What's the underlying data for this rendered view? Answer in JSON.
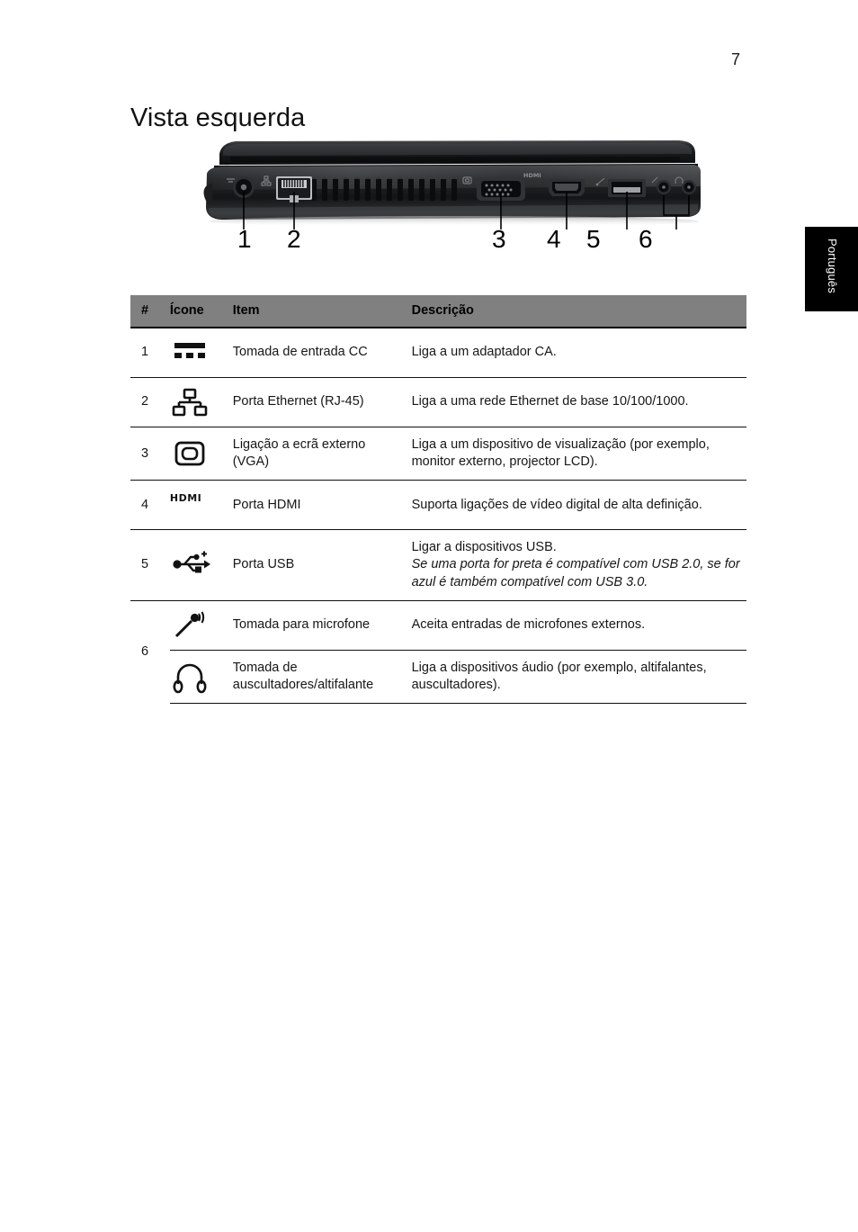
{
  "page": {
    "number": "7",
    "title": "Vista esquerda",
    "language_tab": "Português"
  },
  "figure": {
    "name": "laptop-left-side-view",
    "callouts": [
      {
        "label": "1",
        "target": "dc-in-jack"
      },
      {
        "label": "2",
        "target": "ethernet-port"
      },
      {
        "label": "3",
        "target": "vga-port"
      },
      {
        "label": "4",
        "target": "hdmi-port"
      },
      {
        "label": "5",
        "target": "usb-port"
      },
      {
        "label": "6",
        "target": "audio-jacks"
      }
    ]
  },
  "table": {
    "headers": {
      "num": "#",
      "icon": "Ícone",
      "item": "Item",
      "description": "Descrição"
    },
    "rows": [
      {
        "num": "1",
        "icon": "dc-in-icon",
        "item": "Tomada de entrada CC",
        "description": "Liga a um adaptador CA."
      },
      {
        "num": "2",
        "icon": "ethernet-icon",
        "item": "Porta Ethernet (RJ-45)",
        "description": "Liga a uma rede Ethernet de base 10/100/1000."
      },
      {
        "num": "3",
        "icon": "external-display-icon",
        "item": "Ligação a ecrã externo (VGA)",
        "description": "Liga a um dispositivo de visualização (por exemplo, monitor externo, projector LCD)."
      },
      {
        "num": "4",
        "icon": "hdmi-icon",
        "icon_text": "HDMI",
        "item": "Porta HDMI",
        "description": "Suporta ligações de vídeo digital de alta definição."
      },
      {
        "num": "5",
        "icon": "usb-icon",
        "item": "Porta USB",
        "description": "Ligar a dispositivos USB.",
        "description_italic": "Se uma porta for preta é compatível com USB 2.0, se for azul é também compatível com USB 3.0."
      },
      {
        "num": "6",
        "sub_rows": [
          {
            "icon": "microphone-icon",
            "item": "Tomada para microfone",
            "description": "Aceita entradas de microfones externos."
          },
          {
            "icon": "headphones-icon",
            "item": "Tomada de auscultadores/altifalante",
            "description": "Liga a dispositivos áudio (por exemplo, altifalantes, auscultadores)."
          }
        ]
      }
    ]
  },
  "colors": {
    "header_bg": "#808080",
    "rule": "#111111",
    "tab_bg": "#000000",
    "tab_text": "#ffffff"
  }
}
